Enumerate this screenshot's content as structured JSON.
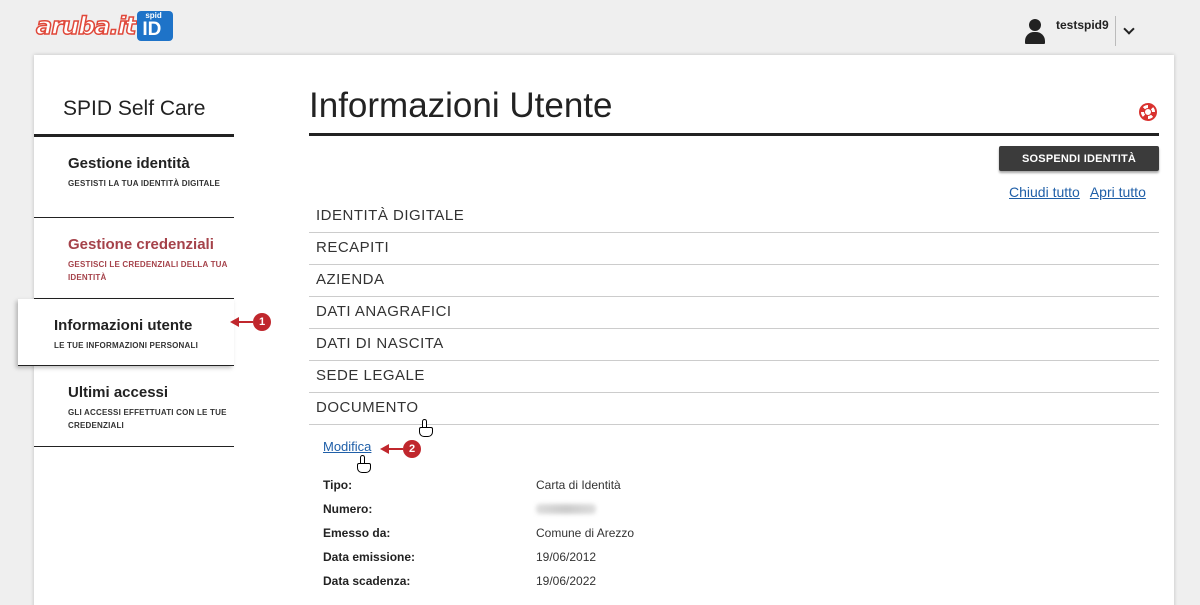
{
  "header": {
    "logo_text": "aruba.it",
    "logo_badge_top": "spid",
    "logo_badge_main": "ID",
    "username": "testspid9"
  },
  "sidebar": {
    "title": "SPID Self Care",
    "items": [
      {
        "title": "Gestione identità",
        "subtitle": "GESTISTI LA TUA IDENTITÀ DIGITALE"
      },
      {
        "title": "Gestione credenziali",
        "subtitle": "GESTISCI LE CREDENZIALI DELLA TUA IDENTITÀ"
      },
      {
        "title": "Informazioni utente",
        "subtitle": "LE TUE INFORMAZIONI PERSONALI"
      },
      {
        "title": "Ultimi accessi",
        "subtitle": "GLI ACCESSI EFFETTUATI CON LE TUE CREDENZIALI"
      }
    ]
  },
  "annotations": {
    "marker1": "1",
    "marker2": "2"
  },
  "main": {
    "title": "Informazioni Utente",
    "suspend_button": "SOSPENDI IDENTITÀ",
    "close_all": "Chiudi tutto",
    "open_all": "Apri tutto",
    "sections": [
      "IDENTITÀ DIGITALE",
      "RECAPITI",
      "AZIENDA",
      "DATI ANAGRAFICI",
      "DATI DI NASCITA",
      "SEDE LEGALE",
      "DOCUMENTO"
    ],
    "edit_link": "Modifica",
    "document": [
      {
        "label": "Tipo:",
        "value": "Carta di Identità"
      },
      {
        "label": "Numero:",
        "value": ""
      },
      {
        "label": "Emesso da:",
        "value": "Comune di Arezzo"
      },
      {
        "label": "Data emissione:",
        "value": "19/06/2012"
      },
      {
        "label": "Data scadenza:",
        "value": "19/06/2022"
      }
    ]
  },
  "colors": {
    "accent_red": "#c0272d",
    "credential_red": "#a5424a",
    "link_blue": "#1f5fa8",
    "button_dark": "#3b3b3b"
  }
}
